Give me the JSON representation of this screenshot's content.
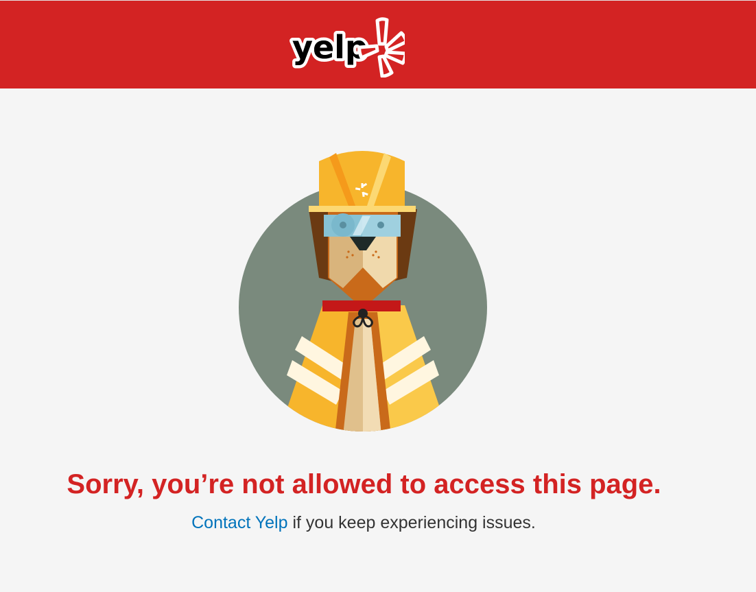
{
  "header": {
    "logo_text": "yelp",
    "logo_icon": "yelp-burst-icon",
    "background_color": "#d32323"
  },
  "illustration": {
    "icon": "construction-dog-illustration",
    "helmet_icon": "yelp-burst-icon"
  },
  "error": {
    "title": "Sorry, you’re not allowed to access this page.",
    "contact_link": "Contact Yelp",
    "suffix": " if you keep experiencing issues.",
    "title_color": "#d32323",
    "link_color": "#0073bb"
  }
}
